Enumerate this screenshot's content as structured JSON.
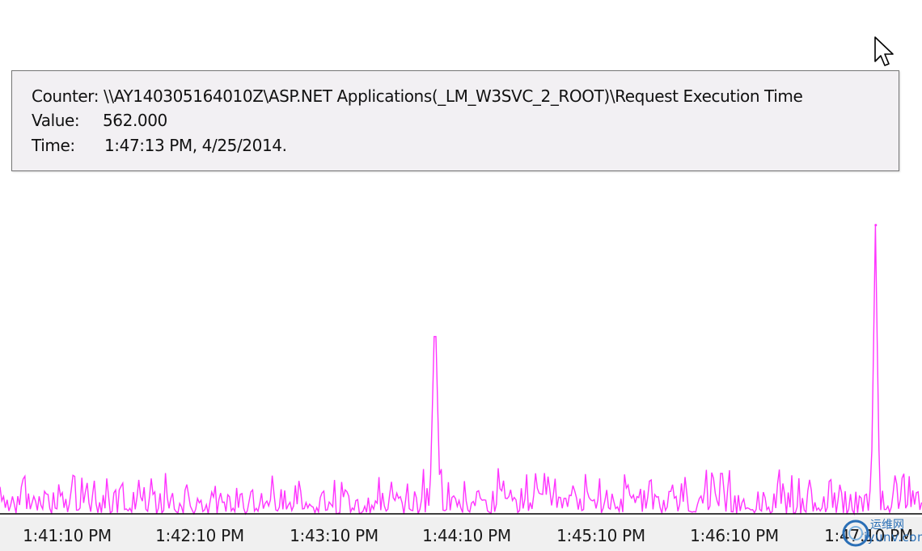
{
  "tooltip": {
    "counter_key": "Counter:",
    "counter_value": "\\\\AY140305164010Z\\ASP.NET Applications(_LM_W3SVC_2_ROOT)\\Request Execution Time",
    "value_key": "Value:",
    "value_value": "562.000",
    "time_key": "Time:",
    "time_value": "1:47:13 PM, 4/25/2014."
  },
  "watermark": {
    "cn": "运维网",
    "en": "iyunv.com"
  },
  "chart_data": {
    "type": "line",
    "series": [
      {
        "color": "#ff33ff"
      }
    ],
    "x_ticks": [
      "1:41:10 PM",
      "1:42:10 PM",
      "1:43:10 PM",
      "1:44:10 PM",
      "1:45:10 PM",
      "1:46:10 PM",
      "1:47:10 PM"
    ],
    "y_range": [
      0,
      1000
    ],
    "highlight_point": {
      "time": "1:47:13 PM",
      "value": 562.0
    },
    "spike_points": [
      {
        "approx_time": "1:43:55 PM",
        "value": 345
      },
      {
        "approx_time": "1:47:13 PM",
        "value": 562
      }
    ],
    "grid": false,
    "legend": "none"
  }
}
